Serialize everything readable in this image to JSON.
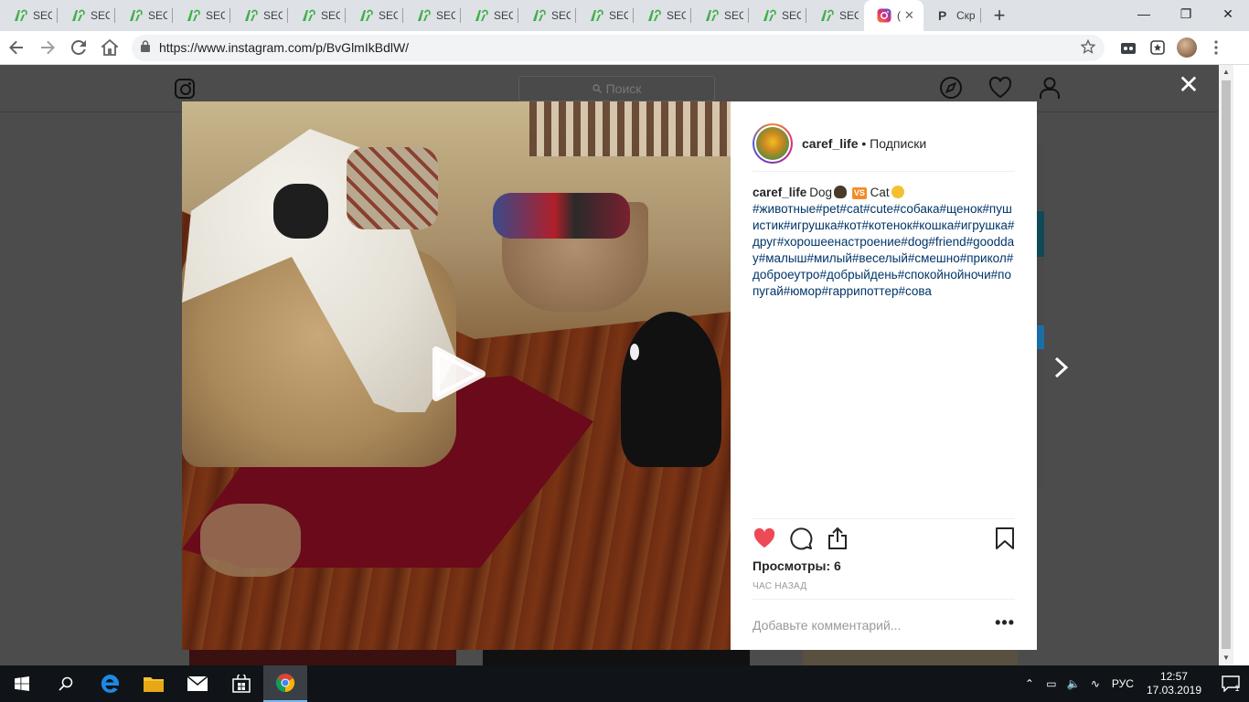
{
  "browser": {
    "tabs": [
      {
        "label": "SEO",
        "favicon": "seo-favicon"
      },
      {
        "label": "SEO",
        "favicon": "seo-favicon"
      },
      {
        "label": "SEO",
        "favicon": "seo-favicon"
      },
      {
        "label": "SEO",
        "favicon": "seo-favicon"
      },
      {
        "label": "SEO",
        "favicon": "seo-favicon"
      },
      {
        "label": "SEO",
        "favicon": "seo-favicon"
      },
      {
        "label": "SEO",
        "favicon": "seo-favicon"
      },
      {
        "label": "SEO",
        "favicon": "seo-favicon"
      },
      {
        "label": "SEO",
        "favicon": "seo-favicon"
      },
      {
        "label": "SEO",
        "favicon": "seo-favicon"
      },
      {
        "label": "SEO",
        "favicon": "seo-favicon"
      },
      {
        "label": "SEO",
        "favicon": "seo-favicon"
      },
      {
        "label": "SEO",
        "favicon": "seo-favicon"
      },
      {
        "label": "SEO",
        "favicon": "seo-favicon"
      },
      {
        "label": "SEO",
        "favicon": "seo-favicon"
      },
      {
        "label": "(",
        "favicon": "instagram-favicon",
        "active": true
      },
      {
        "label": "Скр",
        "favicon": "p-favicon"
      }
    ],
    "new_tab": "+",
    "url": "https://www.instagram.com/p/BvGlmIkBdlW/",
    "accent": "#1a73e8"
  },
  "instagram": {
    "search_placeholder": "Поиск",
    "post": {
      "username": "caref_life",
      "separator": " • ",
      "follow_status": "Подписки",
      "caption_user": "caref_life",
      "caption_text_1": "Dog",
      "caption_vs": "VS",
      "caption_text_2": "Cat",
      "hashtags": "#животные#pet#cat#cute#собака#щенок#пушистик#игрушка#кот#котенок#кошка#игрушка#друг#хорошеенастроение#dog#friend#goodday#малыш#милый#веселый#смешно#прикол#доброеутро#добрыйдень#спокойнойночи#попугай#юмор#гаррипоттер#сова",
      "views": "Просмотры: 6",
      "time": "ЧАС НАЗАД",
      "comment_placeholder": "Добавьте комментарий...",
      "more": "•••"
    },
    "colors": {
      "like": "#ed4956",
      "hashtag": "#003569",
      "text": "#262626",
      "muted": "#999999"
    }
  },
  "taskbar": {
    "language": "РУС",
    "time": "12:57",
    "date": "17.03.2019",
    "notifications": "1"
  }
}
